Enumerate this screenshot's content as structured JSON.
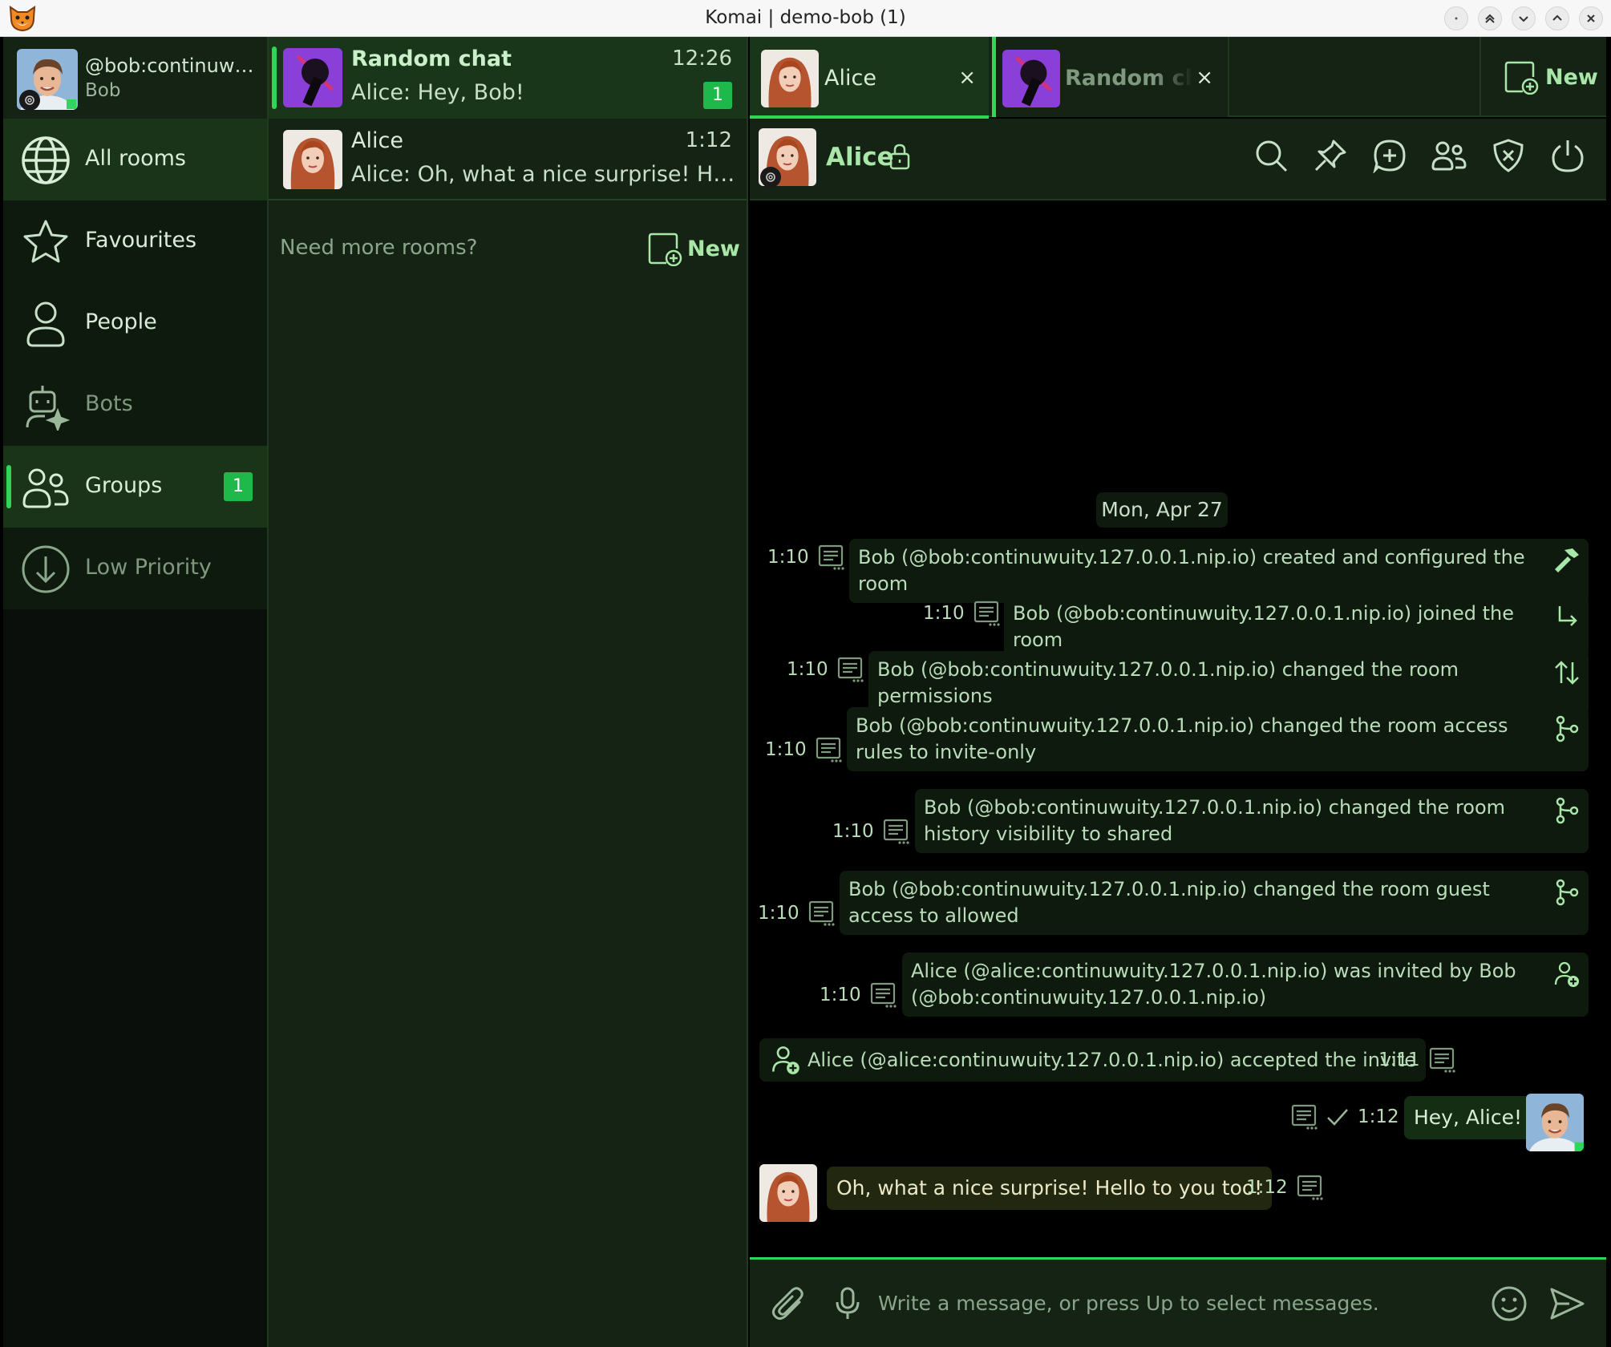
{
  "window": {
    "title": "Komai | demo-bob (1)"
  },
  "account": {
    "user_id": "@bob:continuwui...",
    "display_name": "Bob"
  },
  "nav": {
    "all_rooms": "All rooms",
    "favourites": "Favourites",
    "people": "People",
    "bots": "Bots",
    "groups": "Groups",
    "groups_badge": "1",
    "low_priority": "Low Priority"
  },
  "rooms": [
    {
      "name": "Random chat",
      "time": "12:26",
      "preview": "Alice: Hey, Bob!",
      "badge": "1"
    },
    {
      "name": "Alice",
      "time": "1:12",
      "preview": "Alice: Oh, what a nice surprise! Hello t..."
    }
  ],
  "room_list_footer": {
    "prompt": "Need more rooms?",
    "new_label": "New"
  },
  "tabs": [
    {
      "name": "Alice",
      "close": "×"
    },
    {
      "name": "Random chat",
      "close": "×"
    }
  ],
  "tab_new_label": "New",
  "room_header": {
    "name": "Alice"
  },
  "timeline": {
    "date_separator": "Mon, Apr 27",
    "events": [
      {
        "time": "1:10",
        "text": "Bob (@bob:continuwuity.127.0.0.1.nip.io) created and configured the room",
        "icon": "hammer-icon"
      },
      {
        "time": "1:10",
        "text": "Bob (@bob:continuwuity.127.0.0.1.nip.io) joined the room",
        "icon": "join-arrow-icon"
      },
      {
        "time": "1:10",
        "text": "Bob (@bob:continuwuity.127.0.0.1.nip.io) changed the room permissions",
        "icon": "permissions-arrows-icon"
      },
      {
        "time": "1:10",
        "text": "Bob (@bob:continuwuity.127.0.0.1.nip.io) changed the room access rules to invite-only",
        "icon": "branch-icon"
      },
      {
        "time": "1:10",
        "text": "Bob (@bob:continuwuity.127.0.0.1.nip.io) changed the room history visibility to shared",
        "icon": "branch-icon"
      },
      {
        "time": "1:10",
        "text": "Bob (@bob:continuwuity.127.0.0.1.nip.io) changed the room guest access to allowed",
        "icon": "branch-icon"
      },
      {
        "time": "1:10",
        "text": "Alice (@alice:continuwuity.127.0.0.1.nip.io) was invited by Bob (@bob:continuwuity.127.0.0.1.nip.io)",
        "icon": "user-add-icon"
      }
    ],
    "accept_event": {
      "text": "Alice (@alice:continuwuity.127.0.0.1.nip.io) accepted the invite",
      "time": "1:11"
    },
    "messages": [
      {
        "sender": "Bob",
        "text": "Hey, Alice!",
        "time": "1:12"
      },
      {
        "sender": "Alice",
        "text": "Oh, what a nice surprise! Hello to you too!",
        "time": "1:12"
      }
    ]
  },
  "composer": {
    "placeholder": "Write a message, or press Up to select messages."
  },
  "colors": {
    "accent": "#2ed65a",
    "accent_text": "#a9e7a9",
    "panel": "#142314",
    "background": "#000000"
  }
}
